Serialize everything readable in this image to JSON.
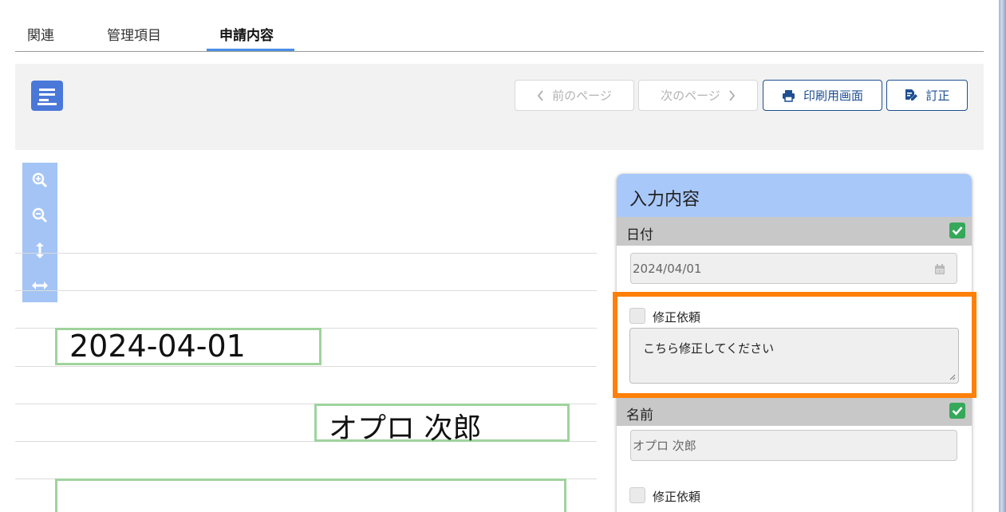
{
  "tabs": [
    {
      "label": "関連"
    },
    {
      "label": "管理項目"
    },
    {
      "label": "申請内容"
    }
  ],
  "toolbar": {
    "prev_label": "前のページ",
    "next_label": "次のページ",
    "print_label": "印刷用画面",
    "correct_label": "訂正",
    "accent_color": "#1e4f91"
  },
  "zoom_tools": [
    "zoom-in-icon",
    "zoom-out-icon",
    "fit-height-icon",
    "fit-width-icon"
  ],
  "document": {
    "date_text": "2024-04-01",
    "name_text": "オプロ 次郎"
  },
  "panel": {
    "title": "入力内容",
    "sections": [
      {
        "label": "日付",
        "value": "2024/04/01",
        "verified": true,
        "correction_label": "修正依頼",
        "correction_checked": false,
        "correction_comment": "こちら修正してください"
      },
      {
        "label": "名前",
        "value": "オプロ 次郎",
        "verified": true,
        "correction_label": "修正依頼",
        "correction_checked": false
      }
    ]
  },
  "highlight_color": "#ff8008"
}
